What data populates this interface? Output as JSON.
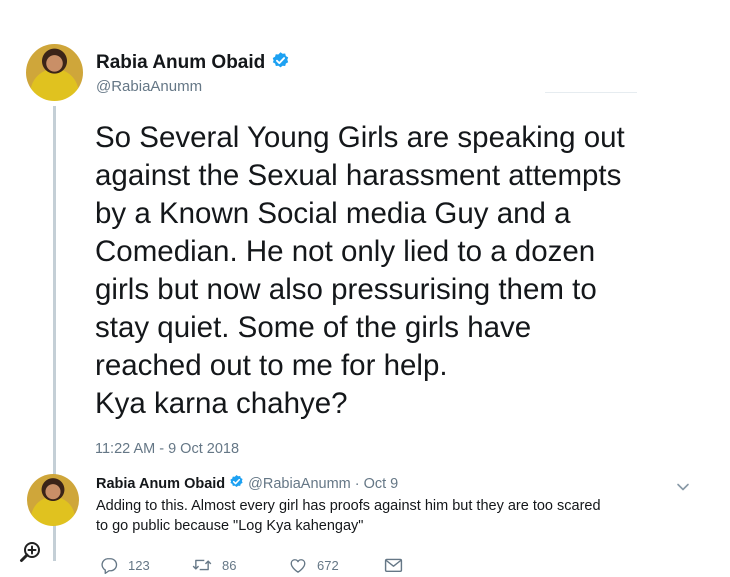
{
  "main_tweet": {
    "author_name": "Rabia Anum Obaid",
    "author_handle": "@RabiaAnumm",
    "text": "So Several Young Girls are speaking out\nagainst the Sexual harassment attempts\nby a Known Social media Guy and a\nComedian. He not only lied to a dozen\ngirls but now also pressurising them to\nstay quiet. Some of the girls have\nreached out to me for help.\nKya karna chahye?",
    "timestamp": "11:22 AM - 9 Oct 2018"
  },
  "reply_tweet": {
    "author_name": "Rabia Anum Obaid",
    "author_handle": "@RabiaAnumm",
    "date": "· Oct 9",
    "text": "Adding to this. Almost every girl has proofs against him but they are too scared\nto go public because \"Log Kya kahengay\"",
    "actions": {
      "replies": "123",
      "retweets": "86",
      "likes": "672"
    }
  },
  "icons": {
    "verified": "verified-badge-icon",
    "reply": "reply-icon",
    "retweet": "retweet-icon",
    "like": "heart-icon",
    "message": "envelope-icon",
    "caret": "chevron-down-icon",
    "zoom": "zoom-in-icon"
  },
  "colors": {
    "verified_blue": "#1da1f2",
    "secondary_text": "#657786",
    "thread_line": "#c4cfd6"
  }
}
